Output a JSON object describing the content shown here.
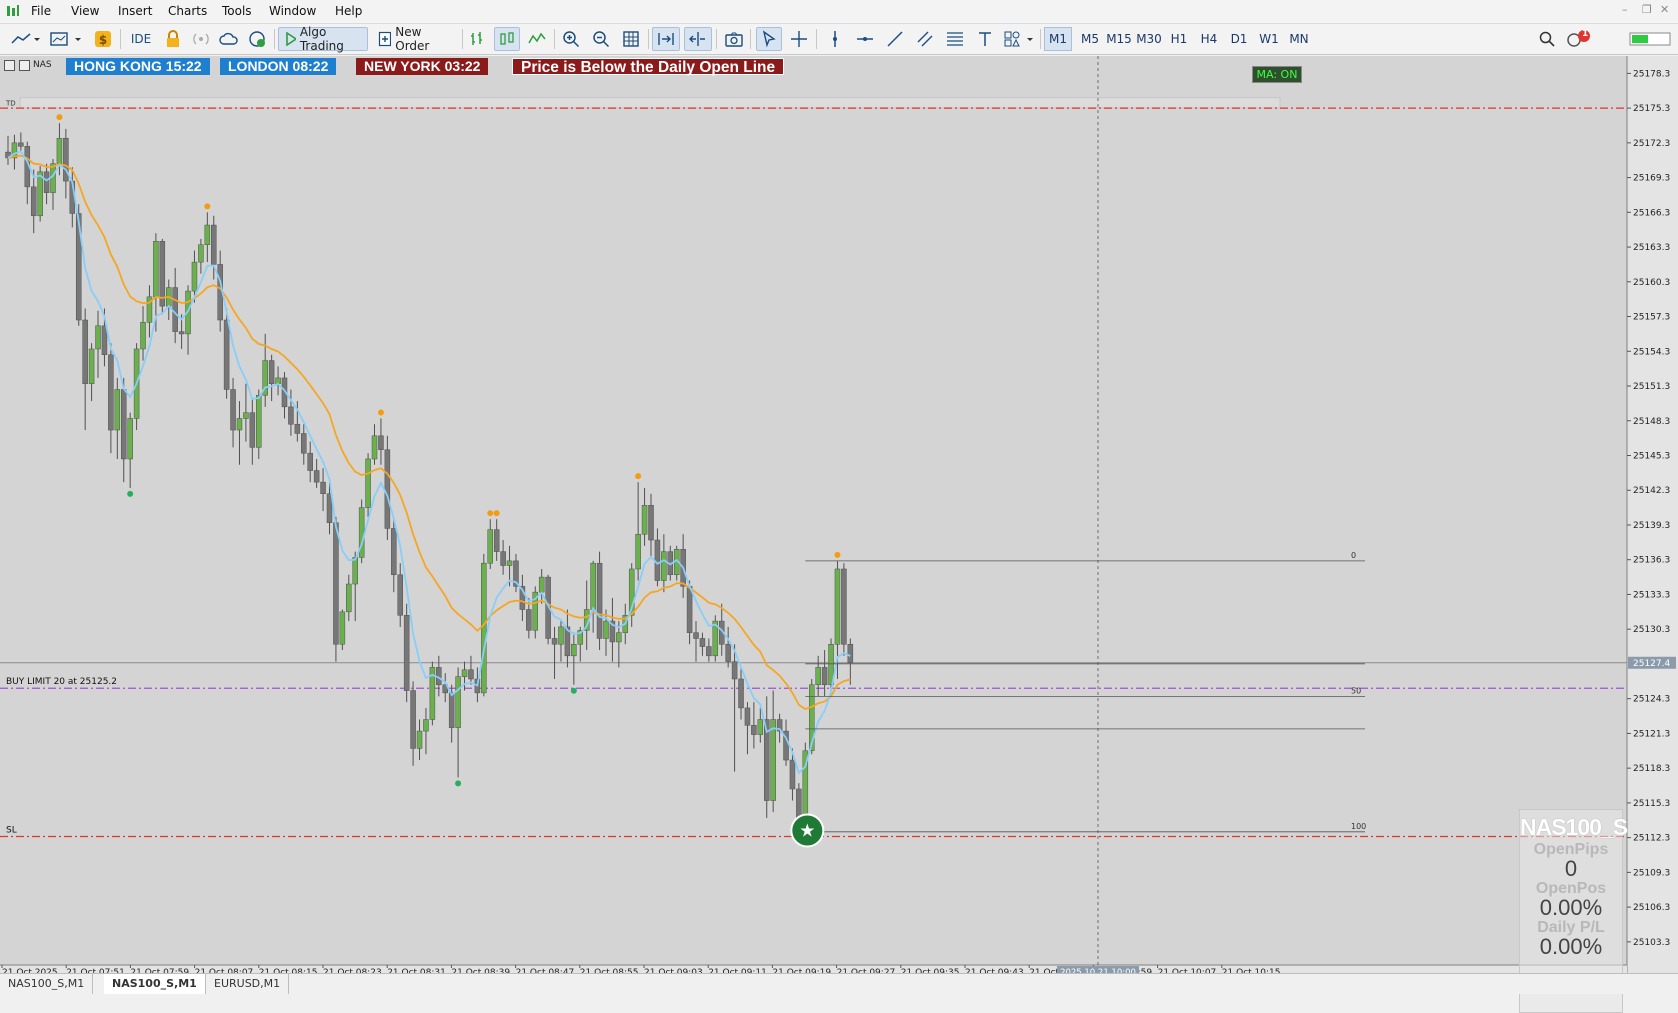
{
  "menu": [
    "File",
    "View",
    "Insert",
    "Charts",
    "Tools",
    "Window",
    "Help"
  ],
  "toolbar": {
    "ide_label": "IDE",
    "algo_label": "Algo Trading",
    "neworder_label": "New Order",
    "timeframes": [
      "M1",
      "M5",
      "M15",
      "M30",
      "H1",
      "H4",
      "D1",
      "W1",
      "MN"
    ],
    "active_timeframe": "M1",
    "notification_count": "1"
  },
  "chart": {
    "clocks": {
      "hk": "HONG KONG 15:22",
      "london": "LONDON  08:22",
      "ny": "NEW YORK 03:22"
    },
    "alert": "Price is Below the Daily Open Line",
    "symbol_short": "NAS",
    "ma_badge": "MA: ON",
    "td_label": "TD",
    "buy_limit_label": "BUY LIMIT 20 at 25125.2",
    "sl_label": "SL",
    "current_price": "25127.4",
    "cursor_time": "2025.10.21 10:00",
    "fib_labels": [
      "0",
      "50",
      "100"
    ],
    "price_ticks": [
      "25178.3",
      "25175.3",
      "25172.3",
      "25169.3",
      "25166.3",
      "25163.3",
      "25160.3",
      "25157.3",
      "25154.3",
      "25151.3",
      "25148.3",
      "25145.3",
      "25142.3",
      "25139.3",
      "25136.3",
      "25133.3",
      "25130.3",
      "25127.4",
      "25124.3",
      "25121.3",
      "25118.3",
      "25115.3",
      "25112.3",
      "25109.3",
      "25106.3",
      "25103.3"
    ],
    "time_ticks": [
      "21 Oct 2025",
      "21 Oct 07:51",
      "21 Oct 07:59",
      "21 Oct 08:07",
      "21 Oct 08:15",
      "21 Oct 08:23",
      "21 Oct 08:31",
      "21 Oct 08:39",
      "21 Oct 08:47",
      "21 Oct 08:55",
      "21 Oct 09:03",
      "21 Oct 09:11",
      "21 Oct 09:19",
      "21 Oct 09:27",
      "21 Oct 09:35",
      "21 Oct 09:43",
      "21 Oct 09:51",
      "21 Oct 09:59",
      "21 Oct 10:07",
      "21 Oct 10:15"
    ],
    "colors": {
      "bull": "#6ab04c",
      "bear": "#777777",
      "ma_slow": "#f5a623",
      "ma_fast": "#87cefa",
      "level": "#e0342f",
      "buy_limit": "#a04fd8",
      "bg": "#d4d4d4"
    }
  },
  "panel": {
    "symbol": "NAS100_S",
    "open_pips_label": "OpenPips",
    "open_pips_value": "0",
    "open_pos_label": "OpenPos",
    "open_pos_value": "0.00%",
    "daily_pl_label": "Daily P/L",
    "daily_pl_value": "0.00%"
  },
  "bottom_tabs": [
    "NAS100_S,M1",
    "NAS100_S,M1",
    "EURUSD,M1"
  ],
  "chart_data": {
    "type": "candlestick",
    "symbol": "NAS100_S",
    "timeframe": "M1",
    "ylim": [
      25101.3,
      25179.8
    ],
    "overlays": [
      "moving average (slow)",
      "moving average (fast)"
    ],
    "levels": {
      "daily_open": 25175.3,
      "buy_limit": 25125.2,
      "sl": 25112.4,
      "bid": 25127.4
    },
    "ohlc": [
      [
        25171.5,
        25172.9,
        25170.4,
        25171.0
      ],
      [
        25171.0,
        25173.0,
        25170.0,
        25172.3
      ],
      [
        25172.3,
        25173.2,
        25171.6,
        25172.0
      ],
      [
        25172.0,
        25172.4,
        25167.0,
        25168.5
      ],
      [
        25168.5,
        25170.0,
        25164.5,
        25166.0
      ],
      [
        25166.0,
        25170.3,
        25165.5,
        25169.8
      ],
      [
        25169.8,
        25170.5,
        25167.0,
        25168.0
      ],
      [
        25168.0,
        25170.9,
        25166.5,
        25170.5
      ],
      [
        25170.5,
        25174.0,
        25169.5,
        25172.7
      ],
      [
        25172.7,
        25173.5,
        25167.5,
        25169.0
      ],
      [
        25169.0,
        25170.2,
        25165.0,
        25166.2
      ],
      [
        25166.2,
        25167.0,
        25156.5,
        25157.0
      ],
      [
        25157.0,
        25158.0,
        25147.5,
        25151.5
      ],
      [
        25151.5,
        25155.0,
        25150.0,
        25154.5
      ],
      [
        25154.5,
        25157.8,
        25152.0,
        25156.5
      ],
      [
        25156.5,
        25158.0,
        25153.0,
        25154.0
      ],
      [
        25154.0,
        25155.0,
        25145.5,
        25147.5
      ],
      [
        25147.5,
        25152.0,
        25145.0,
        25151.0
      ],
      [
        25151.0,
        25152.0,
        25143.0,
        25145.0
      ],
      [
        25145.0,
        25149.0,
        25142.5,
        25148.5
      ],
      [
        25148.5,
        25155.0,
        25147.5,
        25154.5
      ],
      [
        25154.5,
        25158.2,
        25153.5,
        25156.8
      ],
      [
        25156.8,
        25160.0,
        25155.5,
        25159.0
      ],
      [
        25159.0,
        25164.5,
        25156.0,
        25163.8
      ],
      [
        25163.8,
        25164.0,
        25157.5,
        25158.2
      ],
      [
        25158.2,
        25160.5,
        25157.0,
        25159.8
      ],
      [
        25159.8,
        25161.5,
        25155.0,
        25156.0
      ],
      [
        25156.0,
        25157.5,
        25154.5,
        25155.8
      ],
      [
        25155.8,
        25160.0,
        25154.0,
        25159.5
      ],
      [
        25159.5,
        25163.0,
        25158.5,
        25162.0
      ],
      [
        25162.0,
        25164.0,
        25161.0,
        25163.5
      ],
      [
        25163.5,
        25166.3,
        25162.0,
        25165.2
      ],
      [
        25165.2,
        25166.0,
        25160.5,
        25161.8
      ],
      [
        25161.8,
        25163.0,
        25156.0,
        25157.0
      ],
      [
        25157.0,
        25158.0,
        25150.2,
        25151.0
      ],
      [
        25151.0,
        25152.0,
        25146.0,
        25147.5
      ],
      [
        25147.5,
        25150.0,
        25144.5,
        25148.5
      ],
      [
        25148.5,
        25151.5,
        25146.5,
        25149.0
      ],
      [
        25149.0,
        25150.2,
        25144.5,
        25146.0
      ],
      [
        25146.0,
        25151.0,
        25145.0,
        25150.5
      ],
      [
        25150.5,
        25155.8,
        25149.5,
        25153.5
      ],
      [
        25153.5,
        25154.0,
        25150.0,
        25151.5
      ],
      [
        25151.5,
        25153.0,
        25150.5,
        25152.0
      ],
      [
        25152.0,
        25152.5,
        25148.5,
        25149.5
      ],
      [
        25149.5,
        25151.0,
        25147.0,
        25148.0
      ],
      [
        25148.0,
        25150.0,
        25146.5,
        25147.2
      ],
      [
        25147.2,
        25148.0,
        25144.5,
        25145.5
      ],
      [
        25145.5,
        25146.5,
        25143.0,
        25144.0
      ],
      [
        25144.0,
        25145.0,
        25142.5,
        25143.0
      ],
      [
        25143.0,
        25144.2,
        25140.5,
        25142.0
      ],
      [
        25142.0,
        25143.0,
        25138.5,
        25139.5
      ],
      [
        25139.5,
        25140.0,
        25127.5,
        25129.0
      ],
      [
        25129.0,
        25132.0,
        25128.5,
        25131.8
      ],
      [
        25131.8,
        25135.0,
        25131.0,
        25134.2
      ],
      [
        25134.2,
        25137.0,
        25131.0,
        25136.5
      ],
      [
        25136.5,
        25141.5,
        25136.0,
        25140.8
      ],
      [
        25140.8,
        25145.5,
        25140.0,
        25145.0
      ],
      [
        25145.0,
        25148.0,
        25144.5,
        25147.0
      ],
      [
        25147.0,
        25148.5,
        25144.5,
        25145.8
      ],
      [
        25145.8,
        25147.0,
        25138.0,
        25139.0
      ],
      [
        25139.0,
        25140.0,
        25133.5,
        25135.0
      ],
      [
        25135.0,
        25136.0,
        25130.5,
        25131.5
      ],
      [
        25131.5,
        25132.5,
        25124.0,
        25125.0
      ],
      [
        25125.0,
        25125.8,
        25118.5,
        25120.0
      ],
      [
        25120.0,
        25122.5,
        25119.0,
        25121.5
      ],
      [
        25121.5,
        25123.5,
        25119.5,
        25122.5
      ],
      [
        25122.5,
        25127.5,
        25122.0,
        25127.0
      ],
      [
        25127.0,
        25128.0,
        25124.5,
        25125.5
      ],
      [
        25125.5,
        25126.5,
        25124.0,
        25124.8
      ],
      [
        25124.8,
        25125.5,
        25120.5,
        25121.8
      ],
      [
        25121.8,
        25127.0,
        25117.5,
        25126.2
      ],
      [
        25126.2,
        25127.5,
        25125.0,
        25126.8
      ],
      [
        25126.8,
        25128.0,
        25125.5,
        25126.0
      ],
      [
        25126.0,
        25127.0,
        25124.0,
        25124.8
      ],
      [
        25124.8,
        25136.8,
        25124.5,
        25136.0
      ],
      [
        25136.0,
        25139.8,
        25135.5,
        25138.9
      ],
      [
        25138.9,
        25139.8,
        25136.2,
        25137.0
      ],
      [
        25137.0,
        25138.0,
        25135.0,
        25135.8
      ],
      [
        25135.8,
        25137.5,
        25134.0,
        25136.2
      ],
      [
        25136.2,
        25136.8,
        25133.5,
        25134.0
      ],
      [
        25134.0,
        25135.0,
        25131.0,
        25132.0
      ],
      [
        25132.0,
        25133.0,
        25129.5,
        25130.2
      ],
      [
        25130.2,
        25134.0,
        25129.5,
        25133.5
      ],
      [
        25133.5,
        25135.5,
        25132.5,
        25134.8
      ],
      [
        25134.8,
        25135.0,
        25129.0,
        25129.5
      ],
      [
        25129.5,
        25130.5,
        25126.0,
        25129.0
      ],
      [
        25129.0,
        25131.0,
        25127.5,
        25130.5
      ],
      [
        25130.5,
        25132.0,
        25127.0,
        25128.0
      ],
      [
        25128.0,
        25130.0,
        25125.5,
        25129.0
      ],
      [
        25129.0,
        25130.5,
        25127.5,
        25130.2
      ],
      [
        25130.2,
        25134.5,
        25128.5,
        25132.0
      ],
      [
        25132.0,
        25136.2,
        25130.0,
        25136.0
      ],
      [
        25136.0,
        25137.0,
        25128.5,
        25129.5
      ],
      [
        25129.5,
        25132.0,
        25128.0,
        25131.0
      ],
      [
        25131.0,
        25133.0,
        25127.5,
        25129.2
      ],
      [
        25129.2,
        25131.0,
        25127.0,
        25130.0
      ],
      [
        25130.0,
        25132.5,
        25129.0,
        25131.5
      ],
      [
        25131.5,
        25136.0,
        25130.5,
        25135.5
      ],
      [
        25135.5,
        25143.0,
        25134.5,
        25138.5
      ],
      [
        25138.5,
        25142.5,
        25137.5,
        25141.0
      ],
      [
        25141.0,
        25142.0,
        25136.5,
        25138.0
      ],
      [
        25138.0,
        25139.0,
        25134.0,
        25134.5
      ],
      [
        25134.5,
        25138.5,
        25133.5,
        25137.0
      ],
      [
        25137.0,
        25137.5,
        25134.5,
        25135.0
      ],
      [
        25135.0,
        25137.5,
        25134.5,
        25137.2
      ],
      [
        25137.2,
        25138.5,
        25133.0,
        25134.0
      ],
      [
        25134.0,
        25134.5,
        25129.0,
        25130.0
      ],
      [
        25130.0,
        25131.0,
        25127.5,
        25129.5
      ],
      [
        25129.5,
        25130.0,
        25128.0,
        25128.8
      ],
      [
        25128.8,
        25129.5,
        25127.5,
        25128.0
      ],
      [
        25128.0,
        25131.5,
        25127.5,
        25131.0
      ],
      [
        25131.0,
        25132.5,
        25128.0,
        25129.0
      ],
      [
        25129.0,
        25130.5,
        25127.0,
        25127.5
      ],
      [
        25127.5,
        25129.0,
        25118.0,
        25126.0
      ],
      [
        25126.0,
        25127.0,
        25122.5,
        25123.5
      ],
      [
        25123.5,
        25124.0,
        25119.5,
        25122.0
      ],
      [
        25122.0,
        25124.0,
        25120.0,
        25121.2
      ],
      [
        25121.2,
        25123.5,
        25120.5,
        25122.5
      ],
      [
        25122.5,
        25124.5,
        25114.0,
        25115.5
      ],
      [
        25115.5,
        25125.0,
        25114.5,
        25122.5
      ],
      [
        25122.5,
        25123.0,
        25120.5,
        25121.5
      ],
      [
        25121.5,
        25122.5,
        25118.5,
        25119.0
      ],
      [
        25119.0,
        25120.0,
        25115.5,
        25116.5
      ],
      [
        25116.5,
        25117.0,
        25112.8,
        25113.5
      ],
      [
        25113.5,
        25120.5,
        25113.0,
        25119.8
      ],
      [
        25119.8,
        25126.0,
        25119.5,
        25125.5
      ],
      [
        25125.5,
        25128.0,
        25124.5,
        25127.0
      ],
      [
        25127.0,
        25128.5,
        25124.5,
        25125.5
      ],
      [
        25125.5,
        25129.5,
        25125.0,
        25129.0
      ],
      [
        25129.0,
        25136.2,
        25126.0,
        25135.5
      ],
      [
        25135.5,
        25136.0,
        25128.0,
        25129.0
      ],
      [
        25129.0,
        25129.5,
        25125.5,
        25127.4
      ]
    ]
  }
}
